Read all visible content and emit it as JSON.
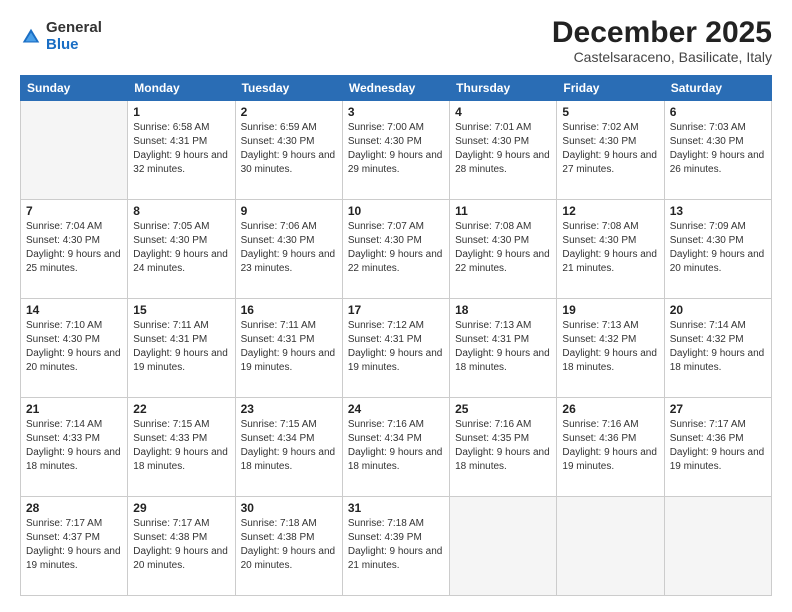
{
  "logo": {
    "general": "General",
    "blue": "Blue"
  },
  "title": "December 2025",
  "location": "Castelsaraceno, Basilicate, Italy",
  "days_header": [
    "Sunday",
    "Monday",
    "Tuesday",
    "Wednesday",
    "Thursday",
    "Friday",
    "Saturday"
  ],
  "weeks": [
    [
      {
        "day": "",
        "sunrise": "",
        "sunset": "",
        "daylight": ""
      },
      {
        "day": "1",
        "sunrise": "Sunrise: 6:58 AM",
        "sunset": "Sunset: 4:31 PM",
        "daylight": "Daylight: 9 hours and 32 minutes."
      },
      {
        "day": "2",
        "sunrise": "Sunrise: 6:59 AM",
        "sunset": "Sunset: 4:30 PM",
        "daylight": "Daylight: 9 hours and 30 minutes."
      },
      {
        "day": "3",
        "sunrise": "Sunrise: 7:00 AM",
        "sunset": "Sunset: 4:30 PM",
        "daylight": "Daylight: 9 hours and 29 minutes."
      },
      {
        "day": "4",
        "sunrise": "Sunrise: 7:01 AM",
        "sunset": "Sunset: 4:30 PM",
        "daylight": "Daylight: 9 hours and 28 minutes."
      },
      {
        "day": "5",
        "sunrise": "Sunrise: 7:02 AM",
        "sunset": "Sunset: 4:30 PM",
        "daylight": "Daylight: 9 hours and 27 minutes."
      },
      {
        "day": "6",
        "sunrise": "Sunrise: 7:03 AM",
        "sunset": "Sunset: 4:30 PM",
        "daylight": "Daylight: 9 hours and 26 minutes."
      }
    ],
    [
      {
        "day": "7",
        "sunrise": "Sunrise: 7:04 AM",
        "sunset": "Sunset: 4:30 PM",
        "daylight": "Daylight: 9 hours and 25 minutes."
      },
      {
        "day": "8",
        "sunrise": "Sunrise: 7:05 AM",
        "sunset": "Sunset: 4:30 PM",
        "daylight": "Daylight: 9 hours and 24 minutes."
      },
      {
        "day": "9",
        "sunrise": "Sunrise: 7:06 AM",
        "sunset": "Sunset: 4:30 PM",
        "daylight": "Daylight: 9 hours and 23 minutes."
      },
      {
        "day": "10",
        "sunrise": "Sunrise: 7:07 AM",
        "sunset": "Sunset: 4:30 PM",
        "daylight": "Daylight: 9 hours and 22 minutes."
      },
      {
        "day": "11",
        "sunrise": "Sunrise: 7:08 AM",
        "sunset": "Sunset: 4:30 PM",
        "daylight": "Daylight: 9 hours and 22 minutes."
      },
      {
        "day": "12",
        "sunrise": "Sunrise: 7:08 AM",
        "sunset": "Sunset: 4:30 PM",
        "daylight": "Daylight: 9 hours and 21 minutes."
      },
      {
        "day": "13",
        "sunrise": "Sunrise: 7:09 AM",
        "sunset": "Sunset: 4:30 PM",
        "daylight": "Daylight: 9 hours and 20 minutes."
      }
    ],
    [
      {
        "day": "14",
        "sunrise": "Sunrise: 7:10 AM",
        "sunset": "Sunset: 4:30 PM",
        "daylight": "Daylight: 9 hours and 20 minutes."
      },
      {
        "day": "15",
        "sunrise": "Sunrise: 7:11 AM",
        "sunset": "Sunset: 4:31 PM",
        "daylight": "Daylight: 9 hours and 19 minutes."
      },
      {
        "day": "16",
        "sunrise": "Sunrise: 7:11 AM",
        "sunset": "Sunset: 4:31 PM",
        "daylight": "Daylight: 9 hours and 19 minutes."
      },
      {
        "day": "17",
        "sunrise": "Sunrise: 7:12 AM",
        "sunset": "Sunset: 4:31 PM",
        "daylight": "Daylight: 9 hours and 19 minutes."
      },
      {
        "day": "18",
        "sunrise": "Sunrise: 7:13 AM",
        "sunset": "Sunset: 4:31 PM",
        "daylight": "Daylight: 9 hours and 18 minutes."
      },
      {
        "day": "19",
        "sunrise": "Sunrise: 7:13 AM",
        "sunset": "Sunset: 4:32 PM",
        "daylight": "Daylight: 9 hours and 18 minutes."
      },
      {
        "day": "20",
        "sunrise": "Sunrise: 7:14 AM",
        "sunset": "Sunset: 4:32 PM",
        "daylight": "Daylight: 9 hours and 18 minutes."
      }
    ],
    [
      {
        "day": "21",
        "sunrise": "Sunrise: 7:14 AM",
        "sunset": "Sunset: 4:33 PM",
        "daylight": "Daylight: 9 hours and 18 minutes."
      },
      {
        "day": "22",
        "sunrise": "Sunrise: 7:15 AM",
        "sunset": "Sunset: 4:33 PM",
        "daylight": "Daylight: 9 hours and 18 minutes."
      },
      {
        "day": "23",
        "sunrise": "Sunrise: 7:15 AM",
        "sunset": "Sunset: 4:34 PM",
        "daylight": "Daylight: 9 hours and 18 minutes."
      },
      {
        "day": "24",
        "sunrise": "Sunrise: 7:16 AM",
        "sunset": "Sunset: 4:34 PM",
        "daylight": "Daylight: 9 hours and 18 minutes."
      },
      {
        "day": "25",
        "sunrise": "Sunrise: 7:16 AM",
        "sunset": "Sunset: 4:35 PM",
        "daylight": "Daylight: 9 hours and 18 minutes."
      },
      {
        "day": "26",
        "sunrise": "Sunrise: 7:16 AM",
        "sunset": "Sunset: 4:36 PM",
        "daylight": "Daylight: 9 hours and 19 minutes."
      },
      {
        "day": "27",
        "sunrise": "Sunrise: 7:17 AM",
        "sunset": "Sunset: 4:36 PM",
        "daylight": "Daylight: 9 hours and 19 minutes."
      }
    ],
    [
      {
        "day": "28",
        "sunrise": "Sunrise: 7:17 AM",
        "sunset": "Sunset: 4:37 PM",
        "daylight": "Daylight: 9 hours and 19 minutes."
      },
      {
        "day": "29",
        "sunrise": "Sunrise: 7:17 AM",
        "sunset": "Sunset: 4:38 PM",
        "daylight": "Daylight: 9 hours and 20 minutes."
      },
      {
        "day": "30",
        "sunrise": "Sunrise: 7:18 AM",
        "sunset": "Sunset: 4:38 PM",
        "daylight": "Daylight: 9 hours and 20 minutes."
      },
      {
        "day": "31",
        "sunrise": "Sunrise: 7:18 AM",
        "sunset": "Sunset: 4:39 PM",
        "daylight": "Daylight: 9 hours and 21 minutes."
      },
      {
        "day": "",
        "sunrise": "",
        "sunset": "",
        "daylight": ""
      },
      {
        "day": "",
        "sunrise": "",
        "sunset": "",
        "daylight": ""
      },
      {
        "day": "",
        "sunrise": "",
        "sunset": "",
        "daylight": ""
      }
    ]
  ]
}
